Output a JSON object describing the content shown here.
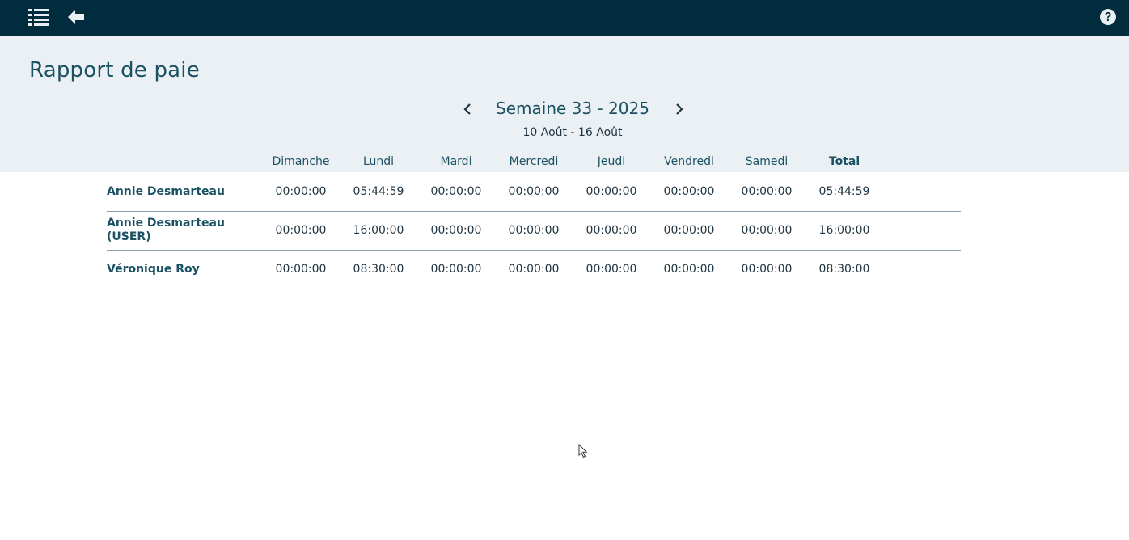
{
  "toolbar": {
    "icons": [
      "list-icon",
      "back-arrow-icon",
      "help-icon"
    ]
  },
  "page": {
    "title": "Rapport de paie"
  },
  "week": {
    "title": "Semaine 33 - 2025",
    "range": "10 Août - 16 Août"
  },
  "table": {
    "columns": [
      "Dimanche",
      "Lundi",
      "Mardi",
      "Mercredi",
      "Jeudi",
      "Vendredi",
      "Samedi",
      "Total"
    ],
    "rows": [
      {
        "name_line1": "Annie Desmarteau",
        "name_line2": "",
        "values": [
          "00:00:00",
          "05:44:59",
          "00:00:00",
          "00:00:00",
          "00:00:00",
          "00:00:00",
          "00:00:00",
          "05:44:59"
        ]
      },
      {
        "name_line1": "Annie Desmarteau",
        "name_line2": "(USER)",
        "values": [
          "00:00:00",
          "16:00:00",
          "00:00:00",
          "00:00:00",
          "00:00:00",
          "00:00:00",
          "00:00:00",
          "16:00:00"
        ]
      },
      {
        "name_line1": "Véronique Roy",
        "name_line2": "",
        "values": [
          "00:00:00",
          "08:30:00",
          "00:00:00",
          "00:00:00",
          "00:00:00",
          "00:00:00",
          "00:00:00",
          "08:30:00"
        ]
      }
    ]
  },
  "colors": {
    "topbar": "#002c3e",
    "header_band": "#ebf0f4",
    "accent_text": "#1a5163"
  }
}
